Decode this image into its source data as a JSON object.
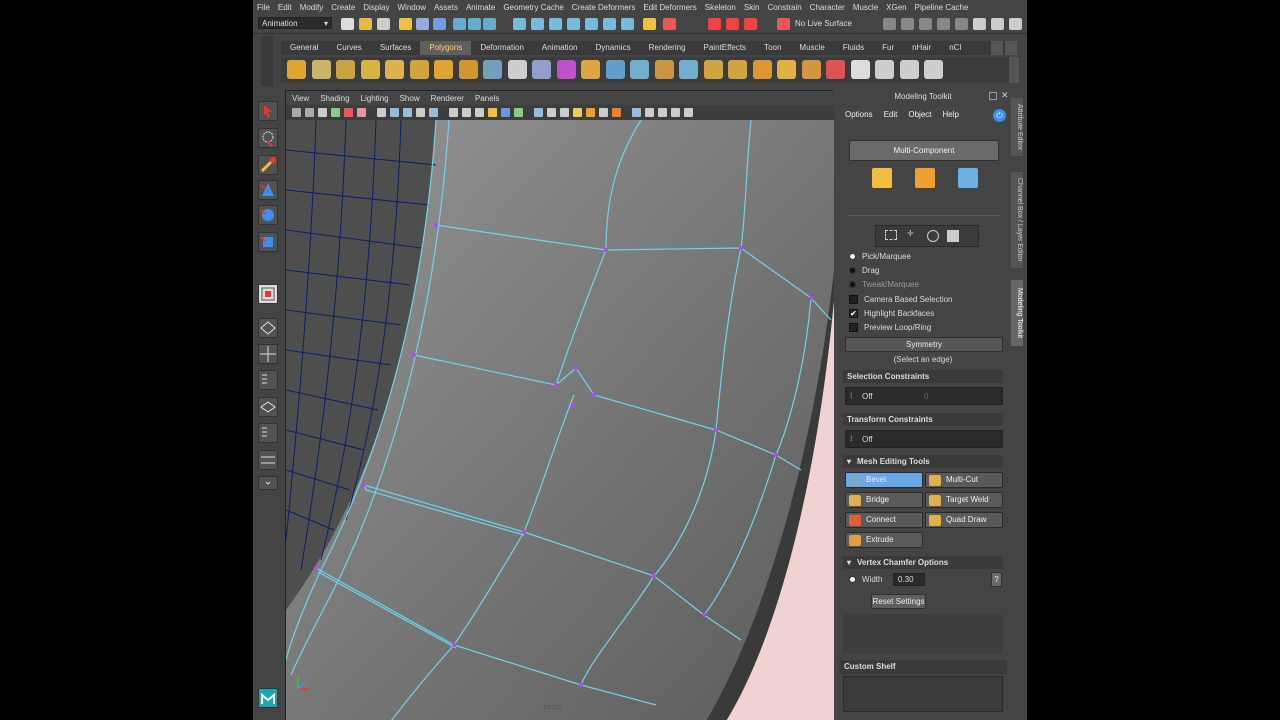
{
  "menu": [
    "File",
    "Edit",
    "Modify",
    "Create",
    "Display",
    "Window",
    "Assets",
    "Animate",
    "Geometry Cache",
    "Create Deformers",
    "Edit Deformers",
    "Skeleton",
    "Skin",
    "Constrain",
    "Character",
    "Muscle",
    "XGen",
    "Pipeline Cache"
  ],
  "status": {
    "mode": "Animation",
    "live_surface": "No Live Surface"
  },
  "shelf_tabs": [
    "General",
    "Curves",
    "Surfaces",
    "Polygons",
    "Deformation",
    "Animation",
    "Dynamics",
    "Rendering",
    "PaintEffects",
    "Toon",
    "Muscle",
    "Fluids",
    "Fur",
    "nHair",
    "nCl"
  ],
  "shelf_active": "Polygons",
  "viewport": {
    "menu": [
      "View",
      "Shading",
      "Lighting",
      "Show",
      "Renderer",
      "Panels"
    ],
    "camera": "persp"
  },
  "modeling_toolkit": {
    "title": "Modeling Toolkit",
    "menu": [
      "Options",
      "Edit",
      "Object",
      "Help"
    ],
    "multi_component": "Multi-Component",
    "pick_options": [
      "Pick/Marquee",
      "Drag",
      "Tweak/Marquee"
    ],
    "checkboxes": [
      {
        "label": "Camera Based Selection",
        "checked": false
      },
      {
        "label": "Highlight Backfaces",
        "checked": true
      },
      {
        "label": "Preview Loop/Ring",
        "checked": false
      }
    ],
    "symmetry": "Symmetry",
    "symmetry_hint": "(Select an edge)",
    "selection_constraints": "Selection Constraints",
    "selection_value": "Off",
    "selection_number": "0",
    "transform_constraints": "Transform Constraints",
    "transform_value": "Off",
    "mesh_editing_tools": "Mesh Editing Tools",
    "tools": [
      "Bevel",
      "Multi-Cut",
      "Bridge",
      "Target Weld",
      "Connect",
      "Quad Draw",
      "Extrude"
    ],
    "vertex_chamfer": "Vertex Chamfer Options",
    "width_label": "Width",
    "width_value": "0.30",
    "help_btn": "?",
    "reset": "Reset Settings",
    "custom_shelf": "Custom Shelf",
    "side_tabs": [
      "Attribute Editor",
      "Channel Box / Layer Editor",
      "Modeling Toolkit"
    ]
  },
  "colors": {
    "selection": "#68a8e8",
    "wire": "#6fd3ee",
    "vertex": "#c040ff"
  }
}
